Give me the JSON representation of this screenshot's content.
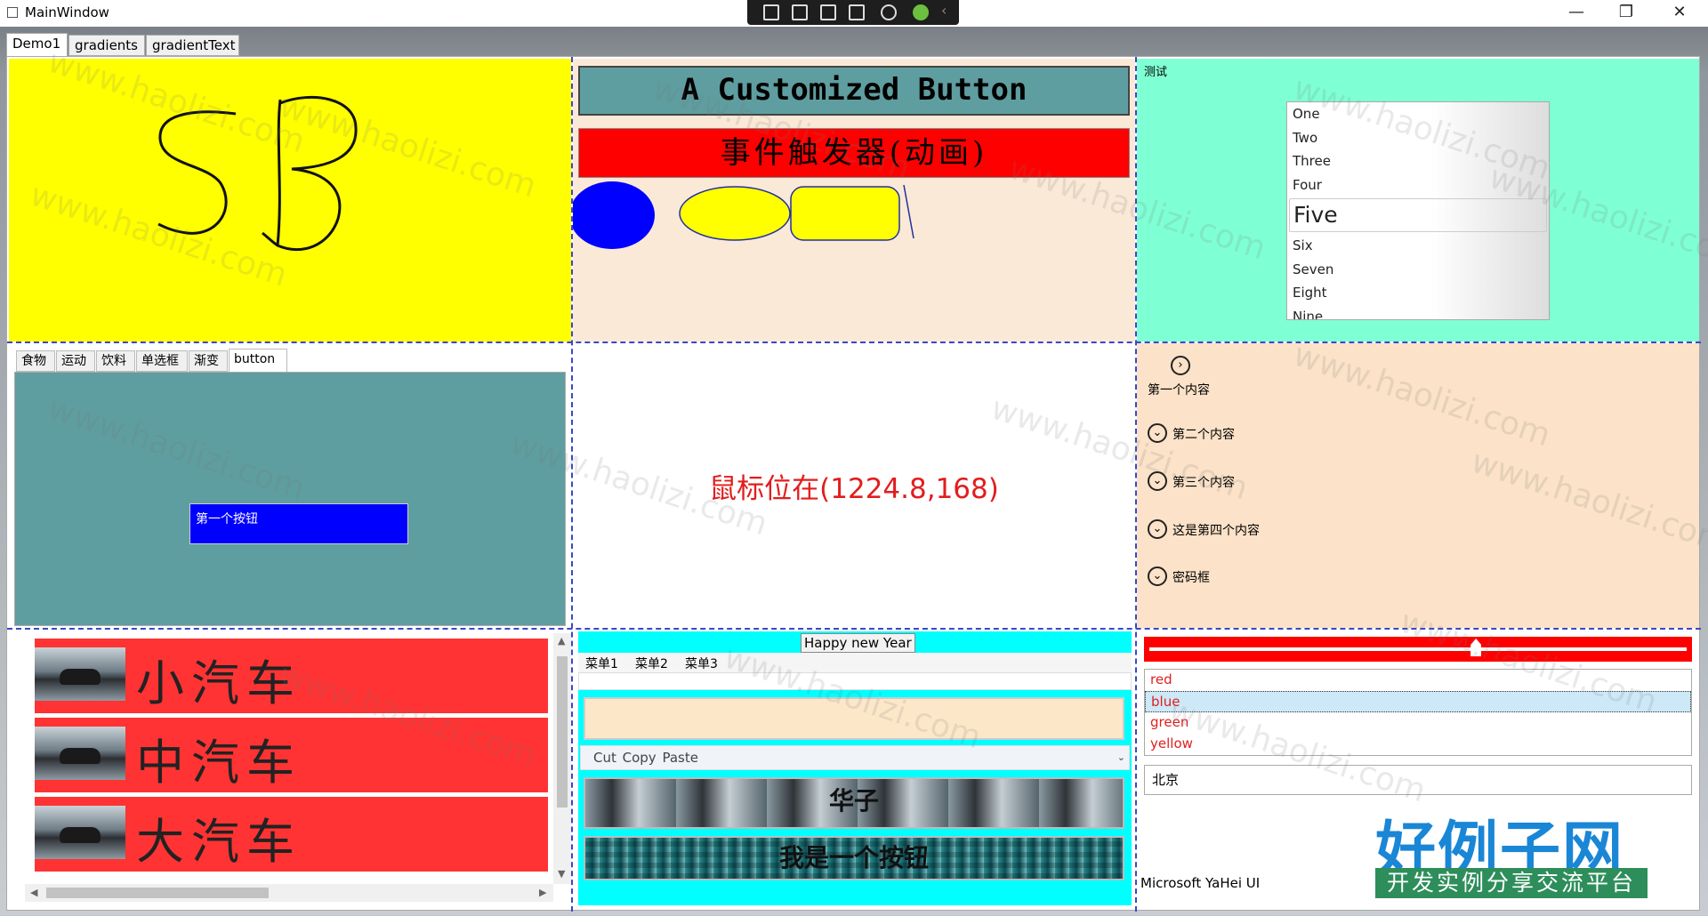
{
  "window": {
    "title": "MainWindow",
    "minimize": "—",
    "restore": "❐",
    "close": "✕"
  },
  "outer_tabs": [
    "Demo1",
    "gradients",
    "gradientText"
  ],
  "cell1": {
    "ink_text": "SB"
  },
  "cell2": {
    "custom_button": "A Customized Button",
    "event_button": "事件触发器(动画)"
  },
  "cell3": {
    "group_label": "测试",
    "list_items": [
      "One",
      "Two",
      "Three",
      "Four",
      "Five",
      "Six",
      "Seven",
      "Eight",
      "Nine"
    ],
    "selected_index": 4
  },
  "cell4": {
    "tabs": [
      "食物",
      "运动",
      "饮料",
      "单选框",
      "渐变",
      "button"
    ],
    "selected_tab": "button",
    "first_button": "第一个按钮"
  },
  "cell5": {
    "mouse_text": "鼠标位在(1224.8,168)"
  },
  "cell6": {
    "expanders": [
      {
        "header": "第一个内容",
        "expanded": true
      },
      {
        "header": "第二个内容",
        "expanded": false
      },
      {
        "header": "第三个内容",
        "expanded": false
      },
      {
        "header": "这是第四个内容",
        "expanded": false
      },
      {
        "header": "密码框",
        "expanded": false
      }
    ]
  },
  "cell7": {
    "cars": [
      "小汽车",
      "中汽车",
      "大汽车"
    ]
  },
  "cell8": {
    "happy_button": "Happy new Year",
    "menus": [
      "菜单1",
      "菜单2",
      "菜单3"
    ],
    "toolbar": "Cut  Copy  Paste",
    "image_button_1": "华子",
    "image_button_2": "我是一个按钮"
  },
  "cell9": {
    "slider_value": 0.61,
    "colors": [
      "red",
      "blue",
      "green",
      "yellow"
    ],
    "selected_color": "blue",
    "textbox_value": "北京",
    "font_label": "Microsoft YaHei UI",
    "brand_title": "好例子网",
    "brand_sub": "开发实例分享交流平台"
  },
  "watermark": "www.haolizi.com",
  "colors": {
    "yellow": "#ffff00",
    "peach": "#fbe9d7",
    "aquamarine": "#7fffd4",
    "cadet": "#5f9ea0",
    "blue": "#0000ff",
    "red": "#ff0000",
    "cyan": "#00ffff",
    "dash": "#3a47c8"
  }
}
